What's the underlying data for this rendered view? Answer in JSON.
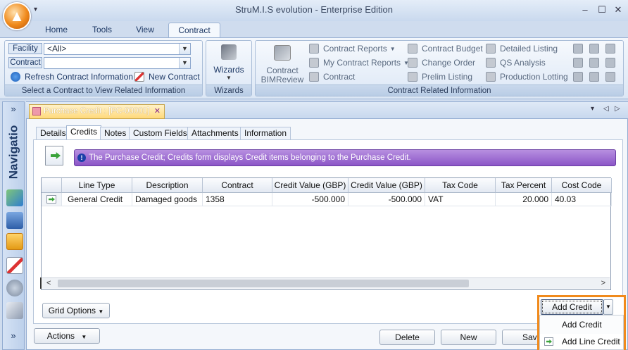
{
  "window": {
    "title": "StruM.I.S evolution - Enterprise Edition",
    "qat_glyph": "▾",
    "min": "–",
    "restore": "☐",
    "close": "✕"
  },
  "ribbon_tabs": [
    {
      "label": "Home"
    },
    {
      "label": "Tools"
    },
    {
      "label": "View"
    },
    {
      "label": "Contract"
    }
  ],
  "selector": {
    "facility_label": "Facility",
    "facility_value": "<All>",
    "contract_label": "Contract",
    "contract_value": "",
    "refresh": "Refresh Contract Information",
    "new_contract": "New Contract",
    "group_label": "Select a Contract to View Related Information"
  },
  "wizards": {
    "label": "Wizards",
    "group_label": "Wizards"
  },
  "related": {
    "bimreview_line1": "Contract",
    "bimreview_line2": "BIMReview",
    "contract_reports": "Contract Reports",
    "my_contract_reports": "My Contract Reports",
    "contract": "Contract",
    "contract_budget": "Contract Budget",
    "change_order": "Change Order",
    "prelim_listing": "Prelim Listing",
    "detailed_listing": "Detailed Listing",
    "qs_analysis": "QS Analysis",
    "production_lotting": "Production Lotting",
    "group_label": "Contract Related Information"
  },
  "nav": {
    "label": "Navigatio",
    "expand_glyph": "»",
    "bottom_glyph": "»"
  },
  "document": {
    "tab_title": "Purchase Credit : [PC-00001]",
    "close_glyph": "✕",
    "strip_glyphs": [
      "▾",
      "◁",
      "▷"
    ]
  },
  "content_tabs": [
    {
      "label": "Details"
    },
    {
      "label": "Credits"
    },
    {
      "label": "Notes"
    },
    {
      "label": "Custom Fields"
    },
    {
      "label": "Attachments"
    },
    {
      "label": "Information"
    }
  ],
  "info_message": "The Purchase Credit; Credits form displays Credit items belonging to the Purchase Credit.",
  "grid": {
    "columns": [
      "Line Type",
      "Description",
      "Contract",
      "Credit Value (GBP)",
      "Credit Value (GBP)",
      "Tax Code",
      "Tax Percent",
      "Cost Code"
    ],
    "rows": [
      [
        "General Credit",
        "Damaged goods",
        "1358",
        "-500.000",
        "-500.000",
        "VAT",
        "20.000",
        "40.03"
      ]
    ]
  },
  "buttons": {
    "grid_options": "Grid Options",
    "actions": "Actions",
    "delete": "Delete",
    "new": "New",
    "save": "Save",
    "add_credit": "Add Credit"
  },
  "add_credit_menu": [
    {
      "label": "Add Credit"
    },
    {
      "label": "Add Line Credit"
    }
  ]
}
